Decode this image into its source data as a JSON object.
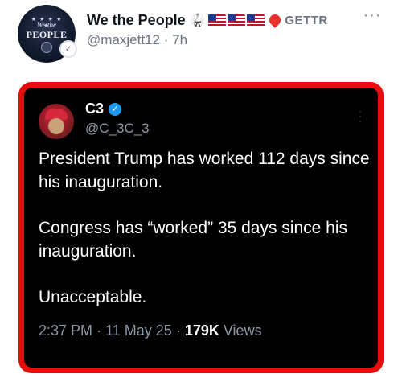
{
  "post": {
    "author_name": "We the People",
    "author_handle": "@maxjett12",
    "separator": "·",
    "time_ago": "7h",
    "badge_label": "GETTR",
    "avatar_text_top": "We the",
    "avatar_text_main": "PEOPLE"
  },
  "quoted": {
    "name": "C3",
    "handle": "@C_3C_3",
    "paragraphs": [
      "President Trump has worked 112 days since his inauguration.",
      "Congress has “worked” 35 days since his inauguration.",
      "Unacceptable."
    ],
    "time": "2:37 PM",
    "date": "11 May 25",
    "views_count": "179K",
    "views_label": "Views",
    "dot": "·"
  },
  "colors": {
    "frame_red": "#e80d0d",
    "verified_blue": "#1d9bf0",
    "gettr_red": "#e8312f"
  }
}
